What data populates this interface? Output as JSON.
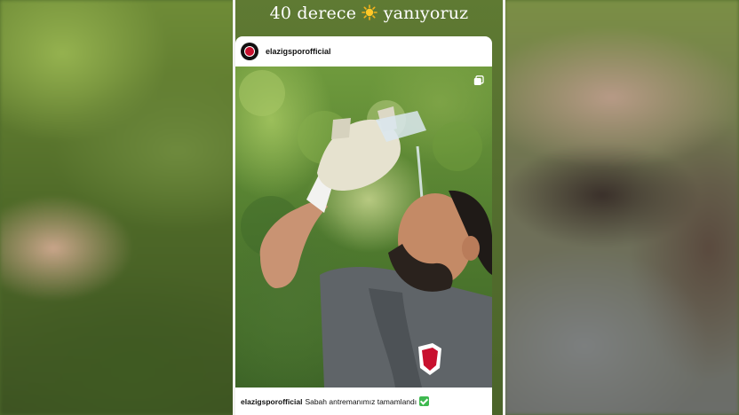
{
  "story": {
    "caption_text": "40 derece",
    "caption_suffix": "yanıyoruz",
    "caption_emoji": "sun-icon"
  },
  "post": {
    "username": "elazigsporofficial",
    "caption_user": "elazigsporofficial",
    "caption_text": "Sabah antremanımız tamamlandı",
    "caption_emoji": "check-mark-icon",
    "multi_image_icon": "carousel-icon"
  },
  "colors": {
    "story_background": "#556f2f",
    "card_background": "#ffffff",
    "check_green": "#3fb950",
    "avatar_red": "#c8102e"
  }
}
